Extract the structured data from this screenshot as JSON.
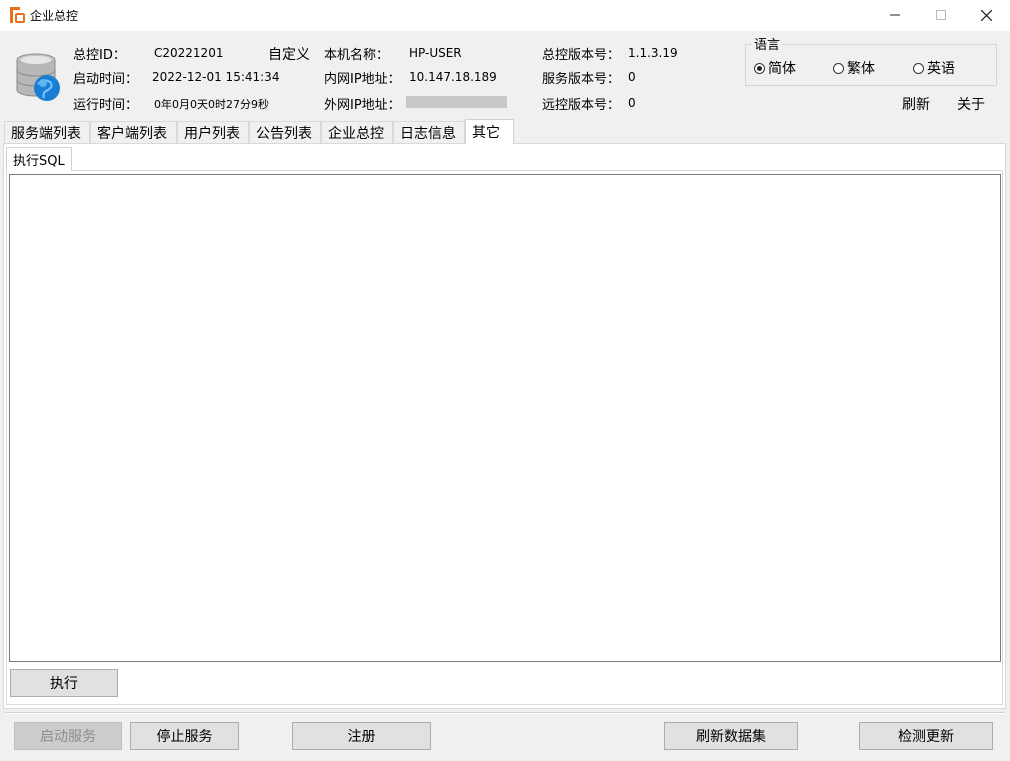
{
  "window": {
    "title": "企业总控",
    "controls": {
      "minimize": "—",
      "maximize": "☐",
      "close": "✕"
    }
  },
  "info": {
    "control_id_label": "总控ID：",
    "control_id_value": "C20221201",
    "custom_label": "自定义",
    "start_time_label": "启动时间：",
    "start_time_value": "2022-12-01 15:41:34",
    "run_time_label": "运行时间：",
    "run_time_value": "0年0月0天0时27分9秒",
    "host_name_label": "本机名称：",
    "host_name_value": "HP-USER",
    "lan_ip_label": "内网IP地址：",
    "lan_ip_value": "10.147.18.189",
    "wan_ip_label": "外网IP地址：",
    "control_version_label": "总控版本号：",
    "control_version_value": "1.1.3.19",
    "service_version_label": "服务版本号：",
    "service_version_value": "0",
    "remote_version_label": "远控版本号：",
    "remote_version_value": "0"
  },
  "language": {
    "legend": "语言",
    "options": [
      {
        "label": "简体",
        "selected": true
      },
      {
        "label": "繁体",
        "selected": false
      },
      {
        "label": "英语",
        "selected": false
      }
    ]
  },
  "actions": {
    "refresh": "刷新",
    "about": "关于"
  },
  "tabs": [
    {
      "label": "服务端列表",
      "active": false
    },
    {
      "label": "客户端列表",
      "active": false
    },
    {
      "label": "用户列表",
      "active": false
    },
    {
      "label": "公告列表",
      "active": false
    },
    {
      "label": "企业总控",
      "active": false
    },
    {
      "label": "日志信息",
      "active": false
    },
    {
      "label": "其它",
      "active": true
    }
  ],
  "subtab": {
    "label": "执行SQL"
  },
  "sql_editor": {
    "value": ""
  },
  "execute_button": "执行",
  "bottom_buttons": {
    "start_service": "启动服务",
    "stop_service": "停止服务",
    "register": "注册",
    "refresh_dataset": "刷新数据集",
    "check_update": "检测更新"
  },
  "colors": {
    "icon_orange": "#e8701a",
    "globe_blue": "#1a7fd4"
  }
}
